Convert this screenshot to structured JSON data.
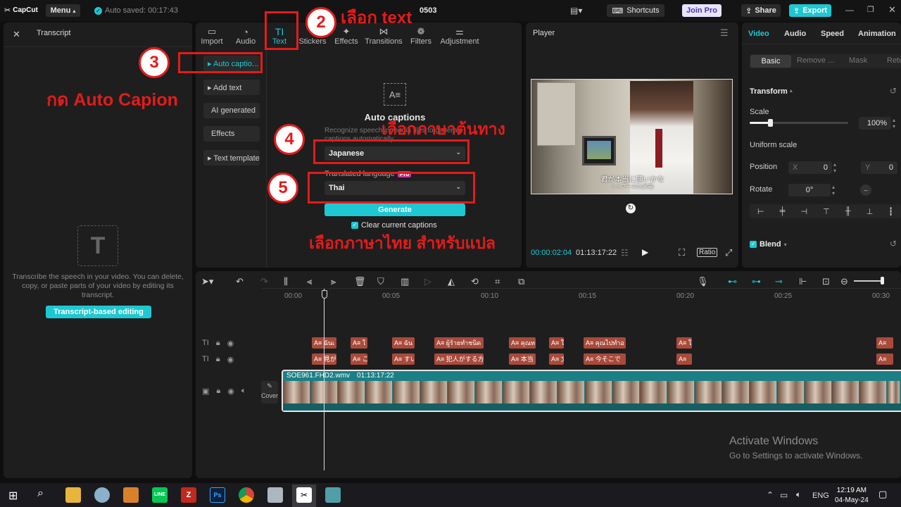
{
  "topbar": {
    "logo": "CapCut",
    "menu_label": "Menu",
    "autosave": "Auto saved: 00:17:43",
    "project_name": "0503",
    "shortcuts": "Shortcuts",
    "join_pro": "Join Pro",
    "share": "Share",
    "export": "Export"
  },
  "transcript": {
    "title": "Transcript",
    "description": "Transcribe the speech in your video. You can delete, copy, or paste parts of your video by editing its transcript.",
    "button": "Transcript-based editing"
  },
  "media_tabs": [
    {
      "label": "Import",
      "icon": "import-icon"
    },
    {
      "label": "Audio",
      "icon": "audio-icon"
    },
    {
      "label": "Text",
      "icon": "text-icon"
    },
    {
      "label": "Stickers",
      "icon": "stickers-icon"
    },
    {
      "label": "Effects",
      "icon": "effects-icon"
    },
    {
      "label": "Transitions",
      "icon": "transitions-icon"
    },
    {
      "label": "Filters",
      "icon": "filters-icon"
    },
    {
      "label": "Adjustment",
      "icon": "adjustment-icon"
    }
  ],
  "text_sidebar": {
    "auto_captions": "▸ Auto captio...",
    "add_text": "▸ Add text",
    "ai_generated": "AI generated",
    "effects": "Effects",
    "text_template": "▸ Text template"
  },
  "auto_captions": {
    "title": "Auto captions",
    "description": "Recognize speech in media files to generate captions automatically.",
    "spoken_language": "Japanese",
    "translated_label": "Translated language",
    "pro_badge": "Pro",
    "translated_language": "Thai",
    "generate": "Generate",
    "clear_label": "Clear current captions"
  },
  "player": {
    "title": "Player",
    "subtitle": "君が本当に願いかな",
    "subtitle2": "トップーズの(演場)",
    "current_time": "00:00:02:04",
    "total_time": "01:13:17:22",
    "ratio": "Ratio"
  },
  "right_panel": {
    "tabs": [
      "Video",
      "Audio",
      "Speed",
      "Animation"
    ],
    "subtabs": [
      "Basic",
      "Remove ...",
      "Mask",
      "Retc"
    ],
    "transform": "Transform",
    "scale_label": "Scale",
    "scale_value": 100,
    "scale_text": "100%",
    "uniform_scale": "Uniform scale",
    "position_label": "Position",
    "pos_x_label": "X",
    "pos_x": "0",
    "pos_y_label": "Y",
    "pos_y": "0",
    "rotate_label": "Rotate",
    "rotate_value": "0°",
    "blend_label": "Blend"
  },
  "timeline": {
    "ticks": [
      "00:00",
      "00:05",
      "00:10",
      "00:15",
      "00:20",
      "00:25",
      "00:30"
    ],
    "track1_captions": [
      "A≡ ฉันเ",
      "A≡ ใ",
      "A≡ ฉัน",
      "A≡ ผู้ร้ายทำชนิด",
      "A≡ คุณท",
      "A≡ ใ",
      "A≡ คุณไปทำอ",
      "A≡ ใ",
      "A≡"
    ],
    "track2_captions": [
      "A≡ 見が",
      "A≡ こ",
      "A≡ すい",
      "A≡ 犯人がする方",
      "A≡ 本当",
      "A≡ 文",
      "A≡ 今そこで",
      "A≡ ",
      "A≡"
    ],
    "video_name": "SOE961.FHD2.wmv",
    "video_duration": "01:13:17:22",
    "cover_label": "Cover"
  },
  "annotations": {
    "step2": "2",
    "step2_text": "เลือก text",
    "step3": "3",
    "step3_text": "กด Auto Capion",
    "step4": "4",
    "step4_text": "เลือกภาษาต้นทาง",
    "step5": "5",
    "step5_text": "เลือกภาษาไทย สำหรับแปล"
  },
  "watermark": {
    "title": "Activate Windows",
    "subtitle": "Go to Settings to activate Windows."
  },
  "taskbar": {
    "lang": "ENG",
    "time": "12:19 AM",
    "date": "04-May-24"
  },
  "colors": {
    "accent": "#1ec8d2",
    "annotation": "#e41b1b",
    "caption_clip": "#a94a3b",
    "video_track": "#1b7f86"
  }
}
